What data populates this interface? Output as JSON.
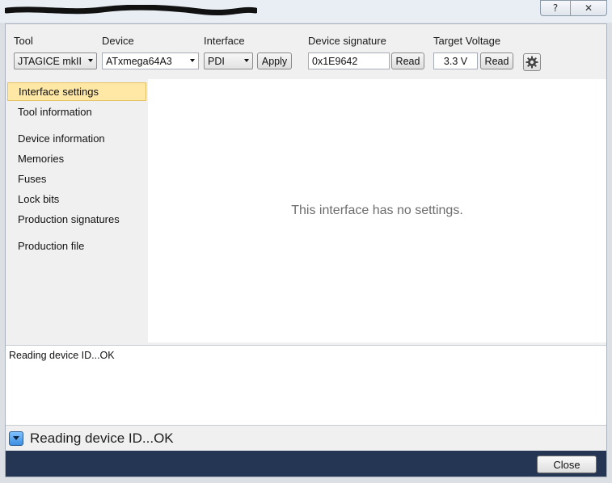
{
  "window": {
    "help_label": "?",
    "close_label": "✕"
  },
  "toolbar": {
    "tool": {
      "label": "Tool",
      "value": "JTAGICE mkII"
    },
    "device": {
      "label": "Device",
      "value": "ATxmega64A3"
    },
    "interface": {
      "label": "Interface",
      "value": "PDI",
      "apply_label": "Apply"
    },
    "signature": {
      "label": "Device signature",
      "value": "0x1E9642",
      "read_label": "Read"
    },
    "voltage": {
      "label": "Target Voltage",
      "value": "3.3 V",
      "read_label": "Read"
    },
    "settings_icon": "gear-icon"
  },
  "sidebar": {
    "items": [
      {
        "label": "Interface settings",
        "active": true
      },
      {
        "label": "Tool information"
      },
      {
        "label": "Device information"
      },
      {
        "label": "Memories"
      },
      {
        "label": "Fuses"
      },
      {
        "label": "Lock bits"
      },
      {
        "label": "Production signatures"
      },
      {
        "label": "Production file"
      }
    ]
  },
  "content": {
    "message": "This interface has no settings."
  },
  "log": {
    "lines": [
      "Reading device ID...OK"
    ]
  },
  "status": {
    "text": "Reading device ID...OK",
    "toggle_icon": "chevron-down-icon"
  },
  "footer": {
    "close_label": "Close"
  },
  "colors": {
    "active_item": "#ffe8a6",
    "footer_bg": "#243654",
    "status_toggle": "#3f8ee0"
  }
}
